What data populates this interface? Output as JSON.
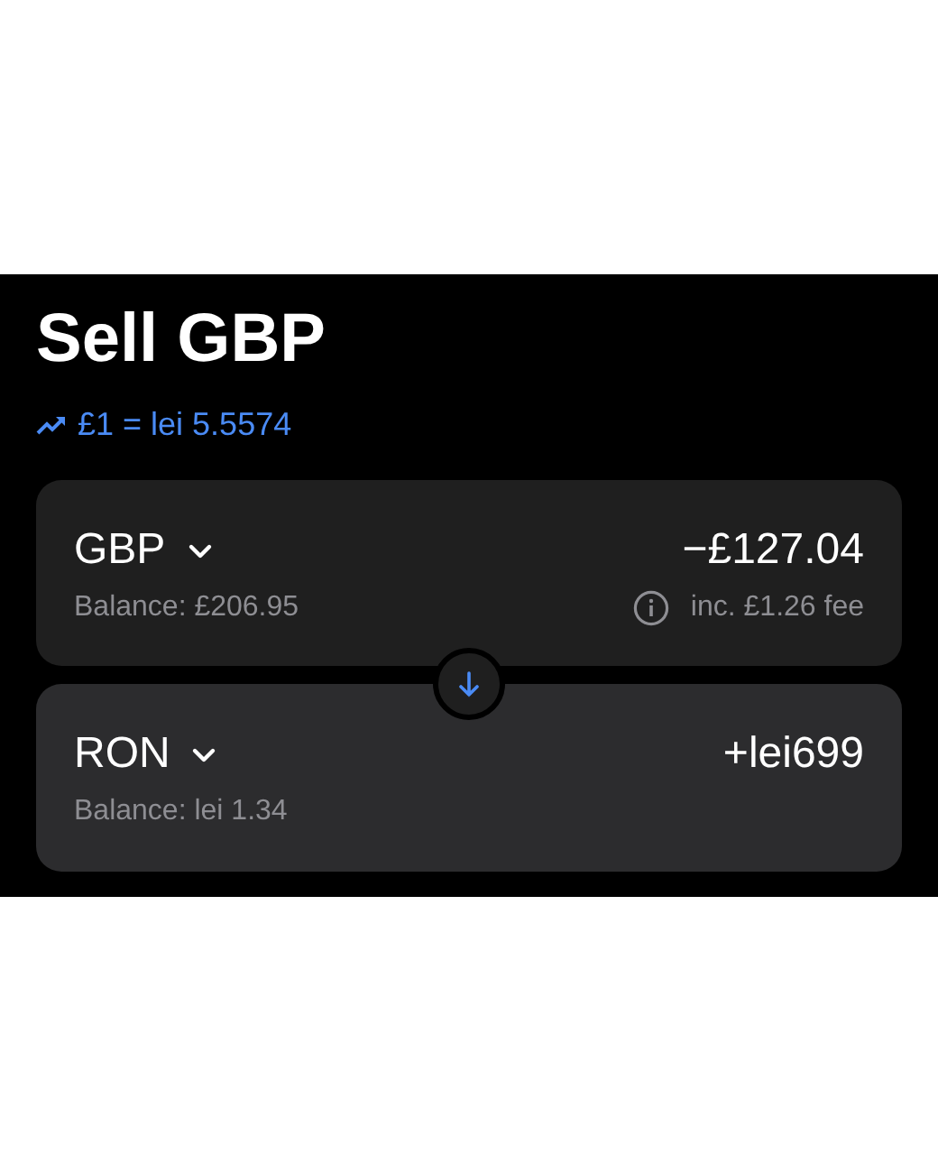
{
  "title": "Sell GBP",
  "rate": "£1 = lei 5.5574",
  "accounts": [
    {
      "currency": "GBP",
      "amount": "−£127.04",
      "balance": "Balance: £206.95",
      "fee": "inc. £1.26 fee",
      "selected": false
    },
    {
      "currency": "RON",
      "amount": "+lei699",
      "balance": "Balance: lei 1.34",
      "selected": true
    }
  ]
}
